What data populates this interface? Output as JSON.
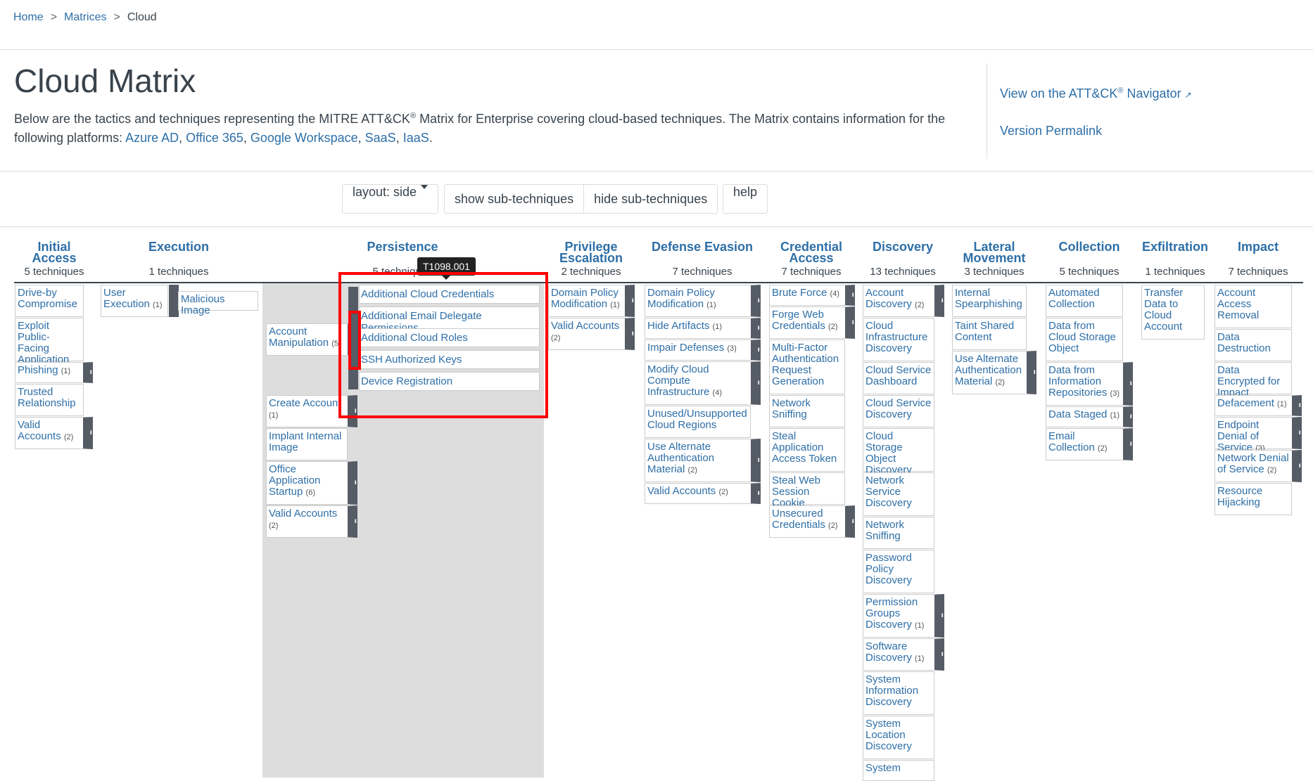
{
  "breadcrumb": {
    "home": "Home",
    "sep": ">",
    "matrices": "Matrices",
    "current": "Cloud"
  },
  "page": {
    "title": "Cloud Matrix",
    "description_start": "Below are the tactics and techniques representing the MITRE ATT&CK",
    "registered": "®",
    "description_end": " Matrix for Enterprise covering cloud-based techniques. The Matrix contains information for the following platforms: ",
    "platforms": [
      "Azure AD",
      "Office 365",
      "Google Workspace",
      "SaaS",
      "IaaS"
    ],
    "comma": ", ",
    "period": "."
  },
  "right_panel": {
    "navigator_label": "View on the ATT&CK",
    "navigator_suffix": " Navigator",
    "permalink_label": "Version Permalink"
  },
  "toolbar": {
    "layout_label": "layout: side",
    "show_label": "show sub-techniques",
    "hide_label": "hide sub-techniques",
    "help_label": "help"
  },
  "tactics": [
    {
      "name": "Initial Access",
      "count": "5 techniques"
    },
    {
      "name": "Execution",
      "count": "1 techniques"
    },
    {
      "name": "Persistence",
      "count": "5 techniques"
    },
    {
      "name": "Privilege Escalation",
      "count": "2 techniques"
    },
    {
      "name": "Defense Evasion",
      "count": "7 techniques"
    },
    {
      "name": "Credential Access",
      "count": "7 techniques"
    },
    {
      "name": "Discovery",
      "count": "13 techniques"
    },
    {
      "name": "Lateral Movement",
      "count": "3 techniques"
    },
    {
      "name": "Collection",
      "count": "5 techniques"
    },
    {
      "name": "Exfiltration",
      "count": "1 techniques"
    },
    {
      "name": "Impact",
      "count": "7 techniques"
    }
  ],
  "tooltip": "T1098.001",
  "techniques": {
    "ia": [
      "Drive-by Compromise",
      "Exploit Public-Facing Application",
      "Phishing",
      "Trusted Relationship",
      "Valid Accounts"
    ],
    "ia_counts": {
      "phishing": "(1)",
      "valid": "(2)"
    },
    "ex": [
      "User Execution",
      "Malicious Image"
    ],
    "ex_counts": {
      "user": "(1)"
    },
    "pe": [
      "Account Manipulation",
      "Create Account",
      "Implant Internal Image",
      "Office Application Startup",
      "Valid Accounts"
    ],
    "pe_counts": {
      "acct": "(5)",
      "create": "(1)",
      "office": "(6)",
      "valid": "(2)"
    },
    "pe_subs": [
      "Additional Cloud Credentials",
      "Additional Email Delegate Permissions",
      "Additional Cloud Roles",
      "SSH Authorized Keys",
      "Device Registration"
    ],
    "pr": [
      "Domain Policy Modification",
      "Valid Accounts"
    ],
    "pr_counts": {
      "dom": "(1)",
      "valid": "(2)"
    },
    "de": [
      "Domain Policy Modification",
      "Hide Artifacts",
      "Impair Defenses",
      "Modify Cloud Compute Infrastructure",
      "Unused/Unsupported Cloud Regions",
      "Use Alternate Authentication Material",
      "Valid Accounts"
    ],
    "de_counts": {
      "dom": "(1)",
      "hide": "(1)",
      "impair": "(3)",
      "modify": "(4)",
      "alt": "(2)",
      "valid": "(2)"
    },
    "ca": [
      "Brute Force",
      "Forge Web Credentials",
      "Multi-Factor Authentication Request Generation",
      "Network Sniffing",
      "Steal Application Access Token",
      "Steal Web Session Cookie",
      "Unsecured Credentials"
    ],
    "ca_counts": {
      "brute": "(4)",
      "forge": "(2)",
      "unsec": "(2)"
    },
    "di": [
      "Account Discovery",
      "Cloud Infrastructure Discovery",
      "Cloud Service Dashboard",
      "Cloud Service Discovery",
      "Cloud Storage Object Discovery",
      "Network Service Discovery",
      "Network Sniffing",
      "Password Policy Discovery",
      "Permission Groups Discovery",
      "Software Discovery",
      "System Information Discovery",
      "System Location Discovery",
      "System"
    ],
    "di_counts": {
      "acct": "(2)",
      "perm": "(1)",
      "soft": "(1)"
    },
    "lm": [
      "Internal Spearphishing",
      "Taint Shared Content",
      "Use Alternate Authentication Material"
    ],
    "lm_counts": {
      "alt": "(2)"
    },
    "co": [
      "Automated Collection",
      "Data from Cloud Storage Object",
      "Data from Information Repositories",
      "Data Staged",
      "Email Collection"
    ],
    "co_counts": {
      "repo": "(3)",
      "staged": "(1)",
      "email": "(2)"
    },
    "exf": [
      "Transfer Data to Cloud Account"
    ],
    "im": [
      "Account Access Removal",
      "Data Destruction",
      "Data Encrypted for Impact",
      "Defacement",
      "Endpoint Denial of Service",
      "Network Denial of Service",
      "Resource Hijacking"
    ],
    "im_counts": {
      "deface": "(1)",
      "endpoint": "(3)",
      "network": "(2)"
    }
  }
}
